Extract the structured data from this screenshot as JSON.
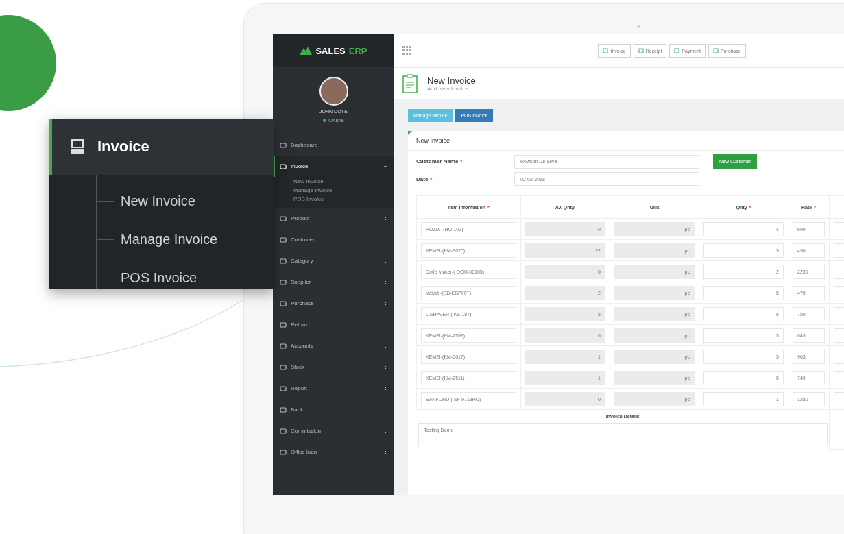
{
  "callout": {
    "title": "Invoice",
    "items": [
      "New Invoice",
      "Manage Invoice",
      "POS Invoice"
    ]
  },
  "sidebar": {
    "logo": {
      "word": "SALES",
      "accent": "ERP"
    },
    "profile": {
      "name": "JOHN DOYE",
      "status": "Online"
    },
    "items": [
      {
        "label": "Dashboard",
        "selected": false,
        "expandable": false
      },
      {
        "label": "Invoice",
        "selected": true,
        "expandable": true,
        "expanded": true,
        "children": [
          "New Invoice",
          "Manage Invoice",
          "POS Invoice"
        ]
      },
      {
        "label": "Product",
        "selected": false,
        "expandable": true,
        "expanded": false
      },
      {
        "label": "Customer",
        "selected": false,
        "expandable": true,
        "expanded": false
      },
      {
        "label": "Category",
        "selected": false,
        "expandable": true,
        "expanded": false
      },
      {
        "label": "Supplier",
        "selected": false,
        "expandable": true,
        "expanded": false
      },
      {
        "label": "Purchase",
        "selected": false,
        "expandable": true,
        "expanded": false
      },
      {
        "label": "Return",
        "selected": false,
        "expandable": true,
        "expanded": false
      },
      {
        "label": "Accounts",
        "selected": false,
        "expandable": true,
        "expanded": false
      },
      {
        "label": "Stock",
        "selected": false,
        "expandable": true,
        "expanded": false
      },
      {
        "label": "Report",
        "selected": false,
        "expandable": true,
        "expanded": false
      },
      {
        "label": "Bank",
        "selected": false,
        "expandable": true,
        "expanded": false
      },
      {
        "label": "Commission",
        "selected": false,
        "expandable": true,
        "expanded": false
      },
      {
        "label": "Office loan",
        "selected": false,
        "expandable": true,
        "expanded": false
      }
    ]
  },
  "toolbar": {
    "buttons": [
      "Invoice",
      "Receipt",
      "Payment",
      "Purchase"
    ]
  },
  "page_header": {
    "title": "New Invoice",
    "subtitle": "Add New Invoice"
  },
  "tabs": [
    {
      "label": "Manage Invoice",
      "selected": false
    },
    {
      "label": "POS Invoice",
      "selected": true
    }
  ],
  "panel": {
    "title": "New Invoice",
    "fields": [
      {
        "label": "Customer Name",
        "mark": "*",
        "value": "Rowson De Silva",
        "button": "New Customer"
      },
      {
        "label": "Date",
        "mark": "*",
        "value": "02-02-2018"
      }
    ],
    "table": {
      "columns": [
        {
          "label": "Item Information",
          "mark": "*"
        },
        {
          "label": "Av. Qnty."
        },
        {
          "label": "Unit"
        },
        {
          "label": "Qnty",
          "mark": "*"
        },
        {
          "label": "Rate",
          "mark": "*"
        }
      ],
      "rows": [
        [
          "ROZIA -(HQ-102)",
          "0",
          "pc",
          "4",
          "690"
        ],
        [
          "KEMEI-(KM-9020)",
          "22",
          "pc",
          "3",
          "490"
        ],
        [
          "Coffe Maker-( OCM-66165)",
          "0",
          "pc",
          "2",
          "2250"
        ],
        [
          "Velvet -(SD-ESP00T)",
          "2",
          "pc",
          "5",
          "470"
        ],
        [
          "L.SHAVER-( KS-187)",
          "5",
          "pc",
          "5",
          "750"
        ],
        [
          "KEMEI-(KM-2599)",
          "6",
          "pc",
          "5",
          "649"
        ],
        [
          "KEMEI-(KM-5017)",
          "1",
          "pc",
          "5",
          "963"
        ],
        [
          "KEMEI-(KM-2511)",
          "1",
          "pc",
          "5",
          "749"
        ],
        [
          "SANFORD-( SF-9713HC)",
          "0",
          "pc",
          "1",
          "1250"
        ]
      ],
      "details_label": "Invoice Details",
      "details_value": "Testing Demo"
    }
  }
}
